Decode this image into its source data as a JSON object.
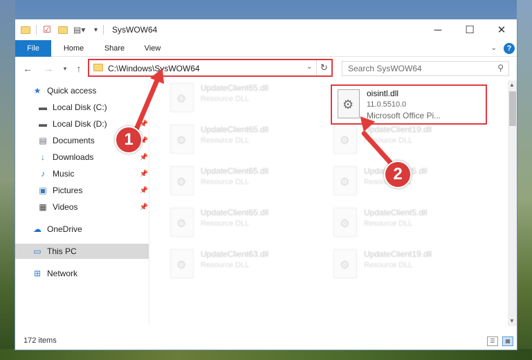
{
  "window": {
    "title": "SysWOW64"
  },
  "controls": {
    "minimize": "─",
    "maximize": "☐",
    "close": "✕"
  },
  "ribbon": {
    "tabs": [
      "File",
      "Home",
      "Share",
      "View"
    ],
    "help": "?"
  },
  "address": {
    "path": "C:\\Windows\\SysWOW64",
    "search_placeholder": "Search SysWOW64"
  },
  "sidebar": {
    "quick_access": "Quick access",
    "items": [
      {
        "label": "Local Disk (C:)",
        "icon": "drive-icon"
      },
      {
        "label": "Local Disk (D:)",
        "icon": "drive-icon"
      },
      {
        "label": "Documents",
        "icon": "documents-icon"
      },
      {
        "label": "Downloads",
        "icon": "downloads-icon"
      },
      {
        "label": "Music",
        "icon": "music-icon"
      },
      {
        "label": "Pictures",
        "icon": "pictures-icon"
      },
      {
        "label": "Videos",
        "icon": "videos-icon"
      }
    ],
    "onedrive": "OneDrive",
    "this_pc": "This PC",
    "network": "Network"
  },
  "files": {
    "highlighted": {
      "name": "oisintl.dll",
      "version": "11.0.5510.0",
      "description": "Microsoft Office Pi..."
    },
    "left_column": [
      {
        "name": "UpdateClient65.dll",
        "type": "Resource DLL"
      },
      {
        "name": "UpdateClient65.dll",
        "type": "Resource DLL"
      },
      {
        "name": "UpdateClient65.dll",
        "type": "Resource DLL"
      },
      {
        "name": "UpdateClient65.dll",
        "type": "Resource DLL"
      },
      {
        "name": "UpdateClient63.dll",
        "type": "Resource DLL"
      }
    ],
    "right_column": [
      {
        "name": "UpdateClient19.dll",
        "type": "Resource DLL"
      },
      {
        "name": "UpdateClient5.dll",
        "type": "Resource DLL"
      },
      {
        "name": "UpdateClient5.dll",
        "type": "Resource DLL"
      },
      {
        "name": "UpdateClient19.dll",
        "type": "Resource DLL"
      }
    ]
  },
  "status": {
    "items": "172 items"
  },
  "annotations": {
    "step1": "1",
    "step2": "2"
  },
  "colors": {
    "accent": "#1979ca",
    "highlight": "#e0393e"
  }
}
